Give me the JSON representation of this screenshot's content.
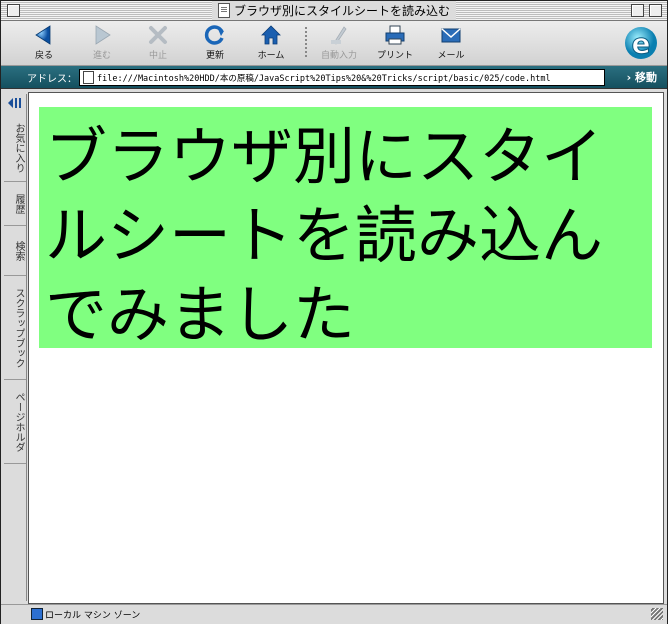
{
  "window": {
    "title": "ブラウザ別にスタイルシートを読み込む"
  },
  "toolbar": {
    "buttons": [
      {
        "label": "戻る",
        "icon": "back-arrow-icon",
        "enabled": true
      },
      {
        "label": "進む",
        "icon": "forward-arrow-icon",
        "enabled": false
      },
      {
        "label": "中止",
        "icon": "stop-x-icon",
        "enabled": false
      },
      {
        "label": "更新",
        "icon": "refresh-icon",
        "enabled": true
      },
      {
        "label": "ホーム",
        "icon": "home-icon",
        "enabled": true
      },
      {
        "label": "自動入力",
        "icon": "autofill-icon",
        "enabled": false
      },
      {
        "label": "プリント",
        "icon": "printer-icon",
        "enabled": true
      },
      {
        "label": "メール",
        "icon": "mail-icon",
        "enabled": true
      }
    ]
  },
  "address": {
    "label": "アドレス：",
    "url": "file:///Macintosh%20HDD/本の原稿/JavaScript%20Tips%20&%20Tricks/script/basic/025/code.html",
    "go_label": "› 移動"
  },
  "sidebar": {
    "tabs": [
      "お気に入り",
      "履歴",
      "検索",
      "スクラップブック",
      "ページホルダ"
    ]
  },
  "content": {
    "heading": "ブラウザ別にスタイルシートを読み込んでみました",
    "heading_bg": "#80ff80"
  },
  "status": {
    "zone": "ローカル マシン ゾーン"
  }
}
